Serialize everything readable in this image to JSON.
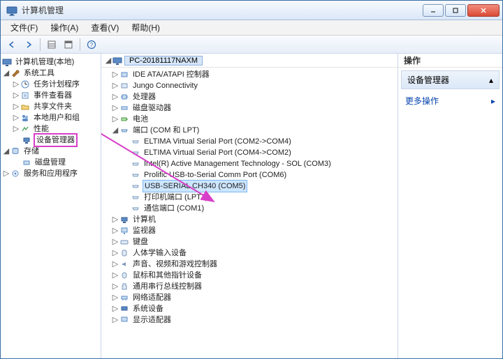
{
  "window": {
    "title": "计算机管理",
    "min_tooltip": "最小化",
    "max_tooltip": "最大化",
    "close_tooltip": "关闭"
  },
  "menu": {
    "file": "文件(F)",
    "action": "操作(A)",
    "view": "查看(V)",
    "help": "帮助(H)"
  },
  "left_tree": {
    "root": "计算机管理(本地)",
    "system_tools": "系统工具",
    "task_scheduler": "任务计划程序",
    "event_viewer": "事件查看器",
    "shared_folders": "共享文件夹",
    "local_users": "本地用户和组",
    "performance": "性能",
    "device_manager": "设备管理器",
    "storage": "存储",
    "disk_mgmt": "磁盘管理",
    "services_apps": "服务和应用程序"
  },
  "mid_header": "PC-20181117NAXM",
  "mid_tree": {
    "root": "PC-20181117NAXM",
    "ide": "IDE ATA/ATAPI 控制器",
    "jungo": "Jungo Connectivity",
    "processor": "处理器",
    "disk_drive": "磁盘驱动器",
    "battery": "电池",
    "ports": "端口 (COM 和 LPT)",
    "port_items": [
      "ELTIMA Virtual Serial Port (COM2->COM4)",
      "ELTIMA Virtual Serial Port (COM4->COM2)",
      "Intel(R) Active Management Technology - SOL (COM3)",
      "Prolific USB-to-Serial Comm Port (COM6)",
      "USB-SERIAL CH340 (COM5)",
      "打印机端口 (LPT1)",
      "通信端口 (COM1)"
    ],
    "computer": "计算机",
    "monitor": "监视器",
    "keyboard": "键盘",
    "hid": "人体学输入设备",
    "sound": "声音、视频和游戏控制器",
    "mouse": "鼠标和其他指针设备",
    "usb_bus": "通用串行总线控制器",
    "network": "网络适配器",
    "system_dev": "系统设备",
    "display": "显示适配器"
  },
  "right": {
    "header": "操作",
    "section": "设备管理器",
    "more": "更多操作"
  }
}
